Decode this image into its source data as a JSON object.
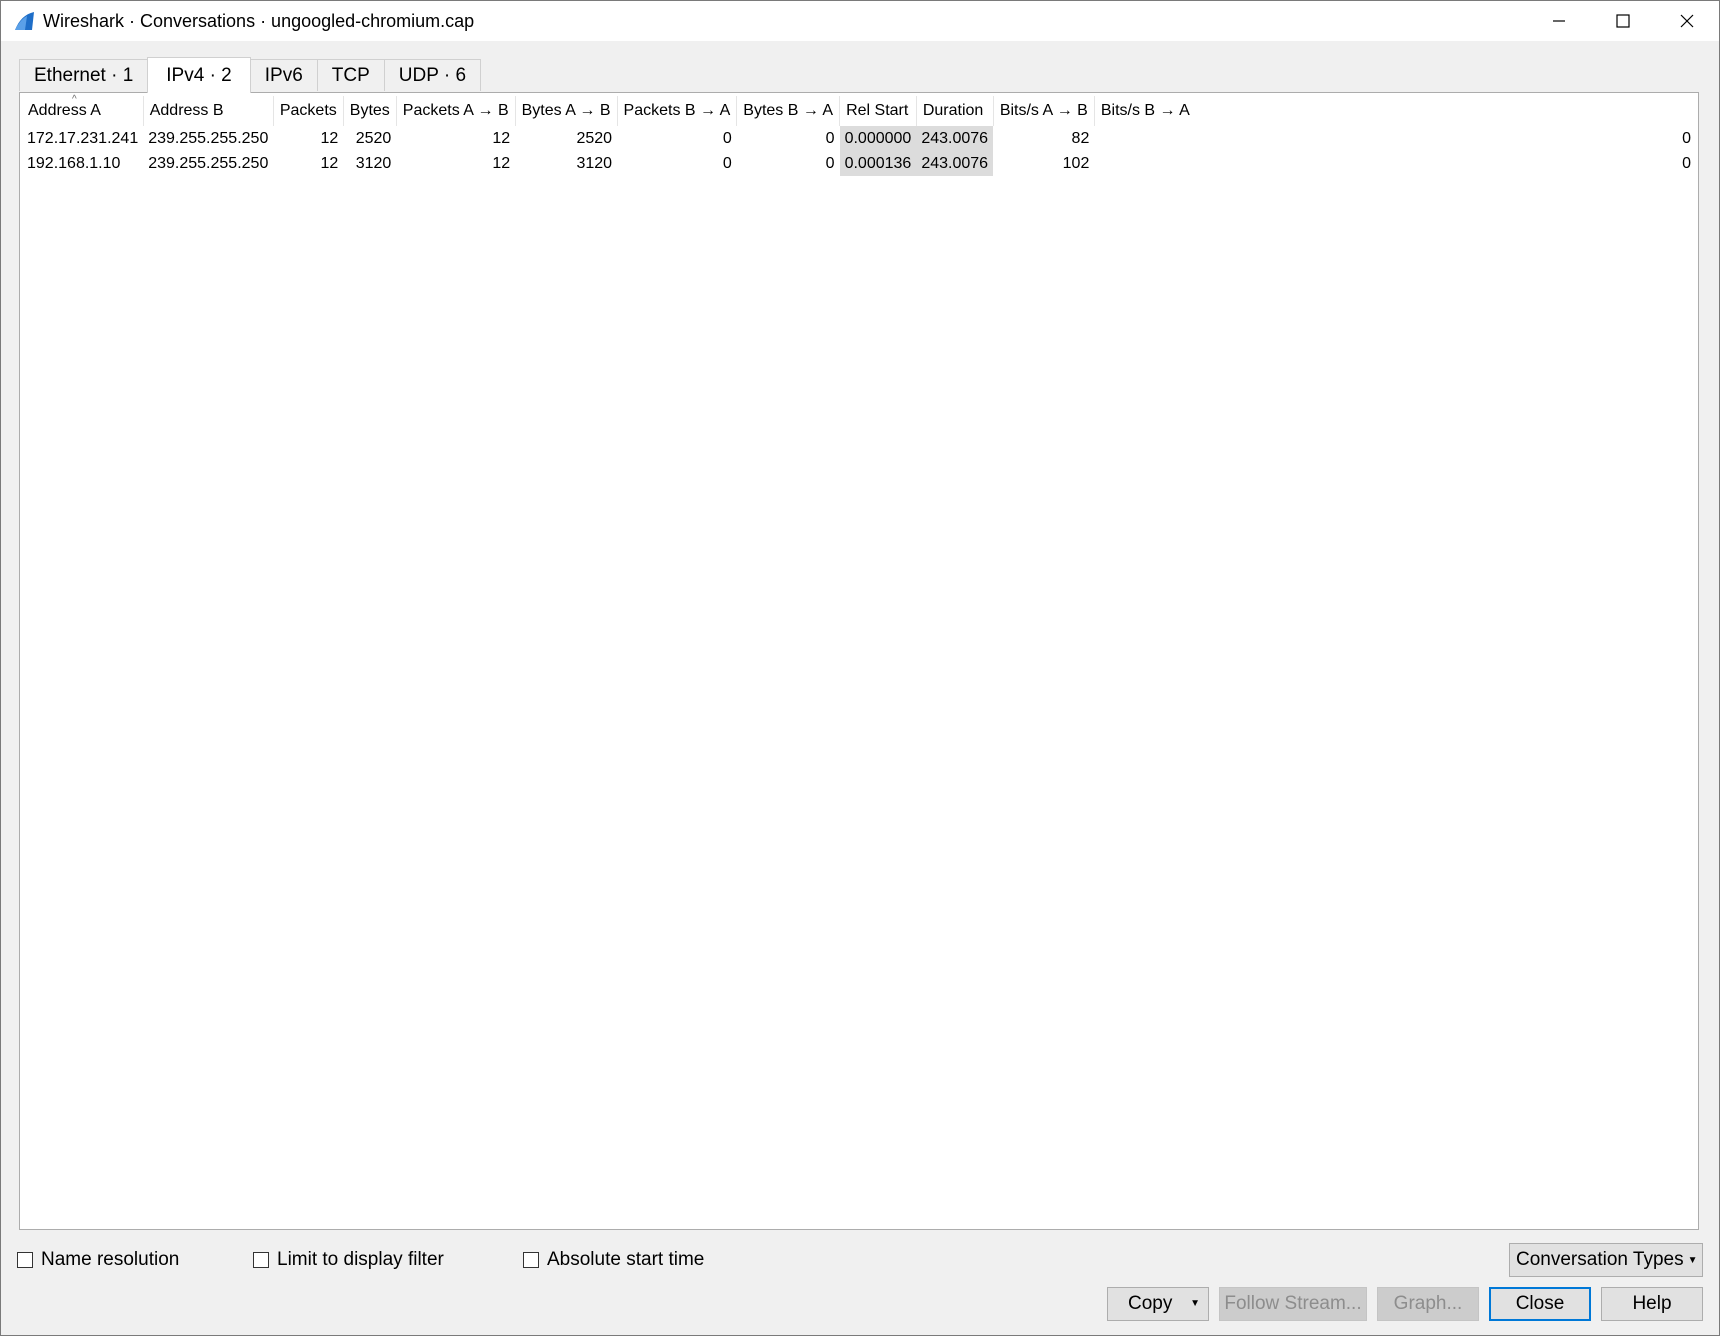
{
  "window": {
    "title": "Wireshark · Conversations · ungoogled-chromium.cap",
    "controls": [
      "minimize-icon",
      "maximize-icon",
      "close-icon"
    ]
  },
  "tabs": [
    {
      "label": "Ethernet · 1",
      "active": false
    },
    {
      "label": "IPv4 · 2",
      "active": true
    },
    {
      "label": "IPv6",
      "active": false
    },
    {
      "label": "TCP",
      "active": false
    },
    {
      "label": "UDP · 6",
      "active": false
    }
  ],
  "table": {
    "sort_column": "Address A",
    "sort_indicator": "^",
    "columns": [
      "Address A",
      "Address B",
      "Packets",
      "Bytes",
      "Packets A → B",
      "Bytes A → B",
      "Packets B → A",
      "Bytes B → A",
      "Rel Start",
      "Duration",
      "Bits/s A → B",
      "Bits/s B → A"
    ],
    "rows": [
      [
        "172.17.231.241",
        "239.255.255.250",
        "12",
        "2520",
        "12",
        "2520",
        "0",
        "0",
        "0.000000",
        "243.0076",
        "82",
        "0"
      ],
      [
        "192.168.1.10",
        "239.255.255.250",
        "12",
        "3120",
        "12",
        "3120",
        "0",
        "0",
        "0.000136",
        "243.0076",
        "102",
        "0"
      ]
    ]
  },
  "options": {
    "name_resolution": "Name resolution",
    "limit_to_display_filter": "Limit to display filter",
    "absolute_start_time": "Absolute start time",
    "conversation_types": "Conversation Types"
  },
  "buttons": {
    "copy": "Copy",
    "follow_stream": "Follow Stream...",
    "graph": "Graph...",
    "close": "Close",
    "help": "Help"
  },
  "colors": {
    "accent": "#0078d7",
    "highlight_cell": "#dcdcdc",
    "shark_fin": "#1e6ec8"
  }
}
